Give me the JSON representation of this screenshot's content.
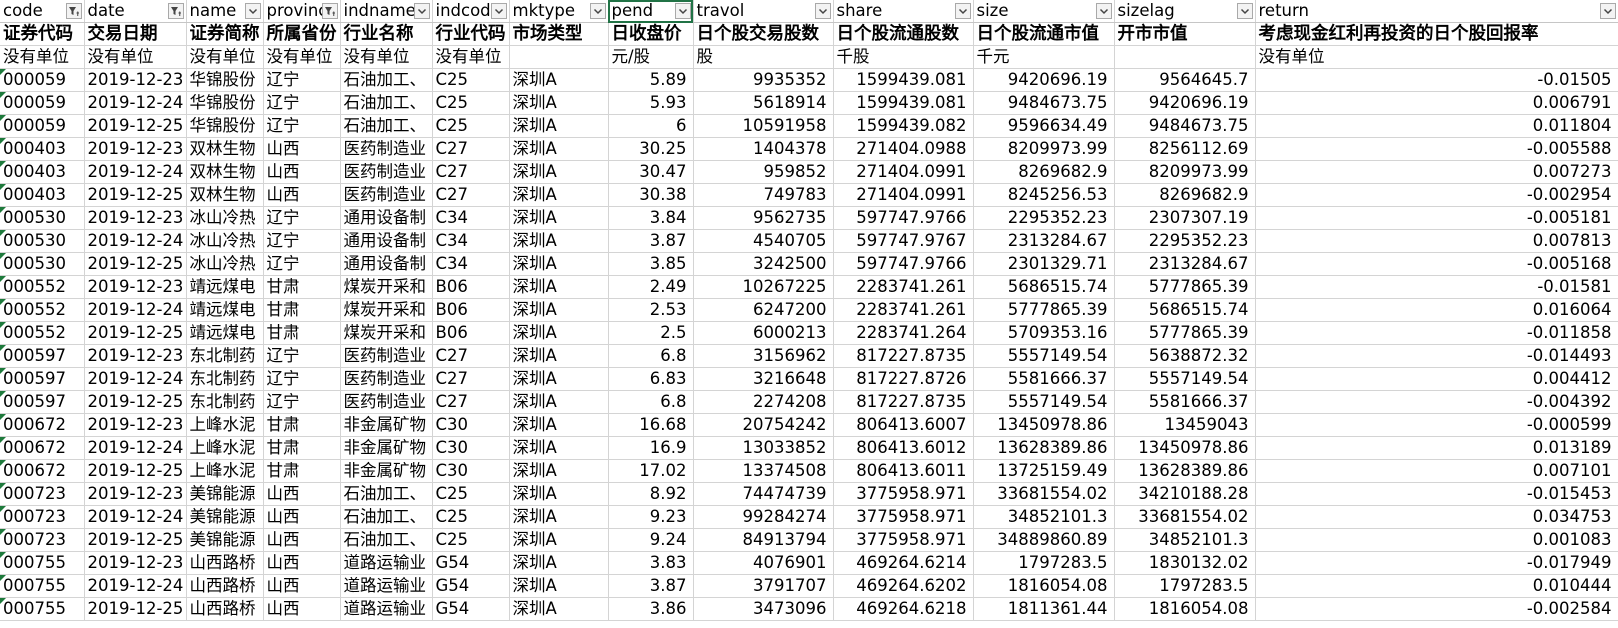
{
  "filters": [
    {
      "label": "code",
      "filtered": true
    },
    {
      "label": "date",
      "filtered": true
    },
    {
      "label": "name",
      "filtered": false
    },
    {
      "label": "provinc",
      "filtered": true
    },
    {
      "label": "indname",
      "filtered": false
    },
    {
      "label": "indcode",
      "filtered": false
    },
    {
      "label": "mktype",
      "filtered": false
    },
    {
      "label": "pend",
      "filtered": false
    },
    {
      "label": "travol",
      "filtered": false
    },
    {
      "label": "share",
      "filtered": false
    },
    {
      "label": "size",
      "filtered": false
    },
    {
      "label": "sizelag",
      "filtered": false
    },
    {
      "label": "return",
      "filtered": false
    }
  ],
  "headers": [
    "证券代码",
    "交易日期",
    "证券简称",
    "所属省份",
    "行业名称",
    "行业代码",
    "市场类型",
    "日收盘价",
    "日个股交易股数",
    "日个股流通股数",
    "日个股流通市值",
    "开市市值",
    "考虑现金红利再投资的日个股回报率"
  ],
  "units": [
    "没有单位",
    "没有单位",
    "没有单位",
    "没有单位",
    "没有单位",
    "没有单位",
    "",
    "元/股",
    "股",
    "千股",
    "千元",
    "",
    "没有单位"
  ],
  "rows": [
    [
      "000059",
      "2019-12-23",
      "华锦股份",
      "辽宁",
      "石油加工、",
      "C25",
      "深圳A",
      "5.89",
      "9935352",
      "1599439.081",
      "9420696.19",
      "9564645.7",
      "-0.01505"
    ],
    [
      "000059",
      "2019-12-24",
      "华锦股份",
      "辽宁",
      "石油加工、",
      "C25",
      "深圳A",
      "5.93",
      "5618914",
      "1599439.081",
      "9484673.75",
      "9420696.19",
      "0.006791"
    ],
    [
      "000059",
      "2019-12-25",
      "华锦股份",
      "辽宁",
      "石油加工、",
      "C25",
      "深圳A",
      "6",
      "10591958",
      "1599439.082",
      "9596634.49",
      "9484673.75",
      "0.011804"
    ],
    [
      "000403",
      "2019-12-23",
      "双林生物",
      "山西",
      "医药制造业",
      "C27",
      "深圳A",
      "30.25",
      "1404378",
      "271404.0988",
      "8209973.99",
      "8256112.69",
      "-0.005588"
    ],
    [
      "000403",
      "2019-12-24",
      "双林生物",
      "山西",
      "医药制造业",
      "C27",
      "深圳A",
      "30.47",
      "959852",
      "271404.0991",
      "8269682.9",
      "8209973.99",
      "0.007273"
    ],
    [
      "000403",
      "2019-12-25",
      "双林生物",
      "山西",
      "医药制造业",
      "C27",
      "深圳A",
      "30.38",
      "749783",
      "271404.0991",
      "8245256.53",
      "8269682.9",
      "-0.002954"
    ],
    [
      "000530",
      "2019-12-23",
      "冰山冷热",
      "辽宁",
      "通用设备制",
      "C34",
      "深圳A",
      "3.84",
      "9562735",
      "597747.9766",
      "2295352.23",
      "2307307.19",
      "-0.005181"
    ],
    [
      "000530",
      "2019-12-24",
      "冰山冷热",
      "辽宁",
      "通用设备制",
      "C34",
      "深圳A",
      "3.87",
      "4540705",
      "597747.9767",
      "2313284.67",
      "2295352.23",
      "0.007813"
    ],
    [
      "000530",
      "2019-12-25",
      "冰山冷热",
      "辽宁",
      "通用设备制",
      "C34",
      "深圳A",
      "3.85",
      "3242500",
      "597747.9766",
      "2301329.71",
      "2313284.67",
      "-0.005168"
    ],
    [
      "000552",
      "2019-12-23",
      "靖远煤电",
      "甘肃",
      "煤炭开采和",
      "B06",
      "深圳A",
      "2.49",
      "10267225",
      "2283741.261",
      "5686515.74",
      "5777865.39",
      "-0.01581"
    ],
    [
      "000552",
      "2019-12-24",
      "靖远煤电",
      "甘肃",
      "煤炭开采和",
      "B06",
      "深圳A",
      "2.53",
      "6247200",
      "2283741.261",
      "5777865.39",
      "5686515.74",
      "0.016064"
    ],
    [
      "000552",
      "2019-12-25",
      "靖远煤电",
      "甘肃",
      "煤炭开采和",
      "B06",
      "深圳A",
      "2.5",
      "6000213",
      "2283741.264",
      "5709353.16",
      "5777865.39",
      "-0.011858"
    ],
    [
      "000597",
      "2019-12-23",
      "东北制药",
      "辽宁",
      "医药制造业",
      "C27",
      "深圳A",
      "6.8",
      "3156962",
      "817227.8735",
      "5557149.54",
      "5638872.32",
      "-0.014493"
    ],
    [
      "000597",
      "2019-12-24",
      "东北制药",
      "辽宁",
      "医药制造业",
      "C27",
      "深圳A",
      "6.83",
      "3216648",
      "817227.8726",
      "5581666.37",
      "5557149.54",
      "0.004412"
    ],
    [
      "000597",
      "2019-12-25",
      "东北制药",
      "辽宁",
      "医药制造业",
      "C27",
      "深圳A",
      "6.8",
      "2274208",
      "817227.8735",
      "5557149.54",
      "5581666.37",
      "-0.004392"
    ],
    [
      "000672",
      "2019-12-23",
      "上峰水泥",
      "甘肃",
      "非金属矿物",
      "C30",
      "深圳A",
      "16.68",
      "20754242",
      "806413.6007",
      "13450978.86",
      "13459043",
      "-0.000599"
    ],
    [
      "000672",
      "2019-12-24",
      "上峰水泥",
      "甘肃",
      "非金属矿物",
      "C30",
      "深圳A",
      "16.9",
      "13033852",
      "806413.6012",
      "13628389.86",
      "13450978.86",
      "0.013189"
    ],
    [
      "000672",
      "2019-12-25",
      "上峰水泥",
      "甘肃",
      "非金属矿物",
      "C30",
      "深圳A",
      "17.02",
      "13374508",
      "806413.6011",
      "13725159.49",
      "13628389.86",
      "0.007101"
    ],
    [
      "000723",
      "2019-12-23",
      "美锦能源",
      "山西",
      "石油加工、",
      "C25",
      "深圳A",
      "8.92",
      "74474739",
      "3775958.971",
      "33681554.02",
      "34210188.28",
      "-0.015453"
    ],
    [
      "000723",
      "2019-12-24",
      "美锦能源",
      "山西",
      "石油加工、",
      "C25",
      "深圳A",
      "9.23",
      "99284274",
      "3775958.971",
      "34852101.3",
      "33681554.02",
      "0.034753"
    ],
    [
      "000723",
      "2019-12-25",
      "美锦能源",
      "山西",
      "石油加工、",
      "C25",
      "深圳A",
      "9.24",
      "84913794",
      "3775958.971",
      "34889860.89",
      "34852101.3",
      "0.001083"
    ],
    [
      "000755",
      "2019-12-23",
      "山西路桥",
      "山西",
      "道路运输业",
      "G54",
      "深圳A",
      "3.83",
      "4076901",
      "469264.6214",
      "1797283.5",
      "1830132.02",
      "-0.017949"
    ],
    [
      "000755",
      "2019-12-24",
      "山西路桥",
      "山西",
      "道路运输业",
      "G54",
      "深圳A",
      "3.87",
      "3791707",
      "469264.6202",
      "1816054.08",
      "1797283.5",
      "0.010444"
    ],
    [
      "000755",
      "2019-12-25",
      "山西路桥",
      "山西",
      "道路运输业",
      "G54",
      "深圳A",
      "3.86",
      "3473096",
      "469264.6218",
      "1811361.44",
      "1816054.08",
      "-0.002584"
    ]
  ],
  "colors": {
    "grid": "#d4d4d4",
    "selection": "#217346",
    "marker": "#1e7a3c",
    "filter_button": "#f3f3f3"
  }
}
